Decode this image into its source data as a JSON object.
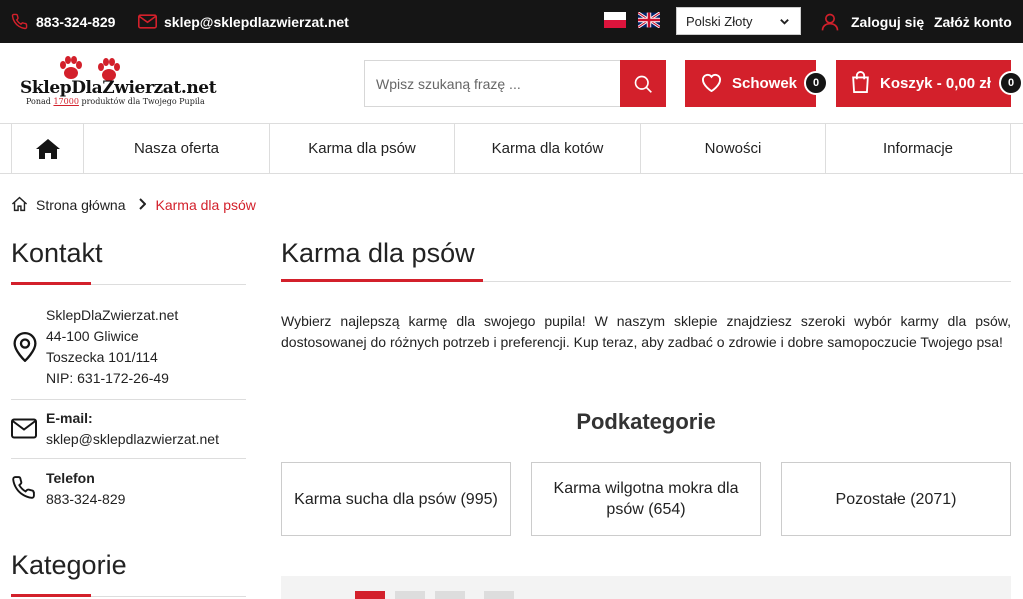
{
  "topbar": {
    "phone": "883-324-829",
    "email": "sklep@sklepdlazwierzat.net",
    "languages": [
      "polish-flag",
      "english-flag"
    ],
    "currency_selected": "Polski Złoty",
    "login_label": "Zaloguj się",
    "register_label": "Załóż konto"
  },
  "header": {
    "logo_name": "SklepDlaZwierzat.net",
    "logo_tagline_prefix": "Ponad",
    "logo_tagline_number": "17000",
    "logo_tagline_suffix": "produktów dla Twojego Pupila",
    "search_placeholder": "Wpisz szukaną frazę ...",
    "wishlist_label": "Schowek",
    "wishlist_count": "0",
    "cart_label": "Koszyk - 0,00 zł",
    "cart_count": "0"
  },
  "nav": {
    "items": [
      "Nasza oferta",
      "Karma dla psów",
      "Karma dla kotów",
      "Nowości",
      "Informacje"
    ]
  },
  "breadcrumb": {
    "home": "Strona główna",
    "current": "Karma dla psów"
  },
  "sidebar": {
    "contact_title": "Kontakt",
    "address_lines": [
      "SklepDlaZwierzat.net",
      "44-100 Gliwice",
      "Toszecka 101/114",
      "NIP: 631-172-26-49"
    ],
    "email_label": "E-mail:",
    "email_value": "sklep@sklepdlazwierzat.net",
    "phone_label": "Telefon",
    "phone_value": "883-324-829",
    "categories_title": "Kategorie"
  },
  "main": {
    "title": "Karma dla psów",
    "description": "Wybierz najlepszą karmę dla swojego pupila! W naszym sklepie znajdziesz szeroki wybór karmy dla psów, dostosowanej do różnych potrzeb i preferencji. Kup teraz, aby zadbać o zdrowie i dobre samopoczucie Twojego psa!",
    "subcategories_title": "Podkategorie",
    "subcategories": [
      "Karma sucha dla psów (995)",
      "Karma wilgotna mokra dla psów (654)",
      "Pozostałe (2071)"
    ]
  },
  "colors": {
    "accent": "#d3202b",
    "topbar": "#151515"
  }
}
